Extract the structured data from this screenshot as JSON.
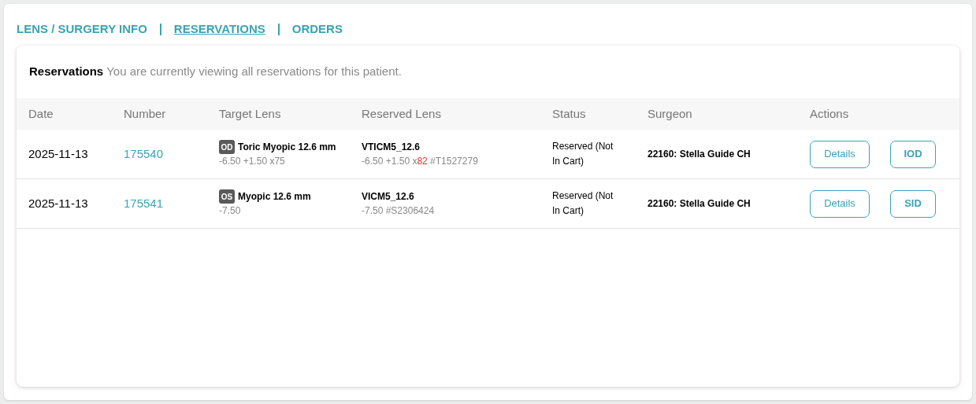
{
  "tabs": [
    {
      "label": "LENS / SURGERY INFO",
      "selected": false
    },
    {
      "label": "RESERVATIONS",
      "selected": true
    },
    {
      "label": "ORDERS",
      "selected": false
    }
  ],
  "panel": {
    "title": "Reservations",
    "subtitle": "You are currently viewing all reservations for this patient."
  },
  "table": {
    "columns": [
      "Date",
      "Number",
      "Target Lens",
      "Reserved Lens",
      "Status",
      "Surgeon",
      "Actions"
    ],
    "rows": [
      {
        "date": "2025-11-13",
        "number": "175540",
        "eye": "OD",
        "target_lens": "Toric Myopic 12.6 mm",
        "target_spec": "-6.50 +1.50 x75",
        "reserved_lens": "VTICM5_12.6",
        "reserved_spec": [
          {
            "text": "-6.50 +1.50 x",
            "mismatch": false
          },
          {
            "text": "82",
            "mismatch": true
          },
          {
            "text": " #T1527279",
            "mismatch": false
          }
        ],
        "status": "Reserved (Not In Cart)",
        "surgeon": "22160: Stella Guide CH",
        "actions": [
          "Details",
          "IOD"
        ]
      },
      {
        "date": "2025-11-13",
        "number": "175541",
        "eye": "OS",
        "target_lens": "Myopic 12.6 mm",
        "target_spec": "-7.50",
        "reserved_lens": "VICM5_12.6",
        "reserved_spec": [
          {
            "text": "-7.50 #S2306424",
            "mismatch": false
          }
        ],
        "status": "Reserved (Not In Cart)",
        "surgeon": "22160: Stella Guide CH",
        "actions": [
          "Details",
          "SID"
        ]
      }
    ]
  }
}
